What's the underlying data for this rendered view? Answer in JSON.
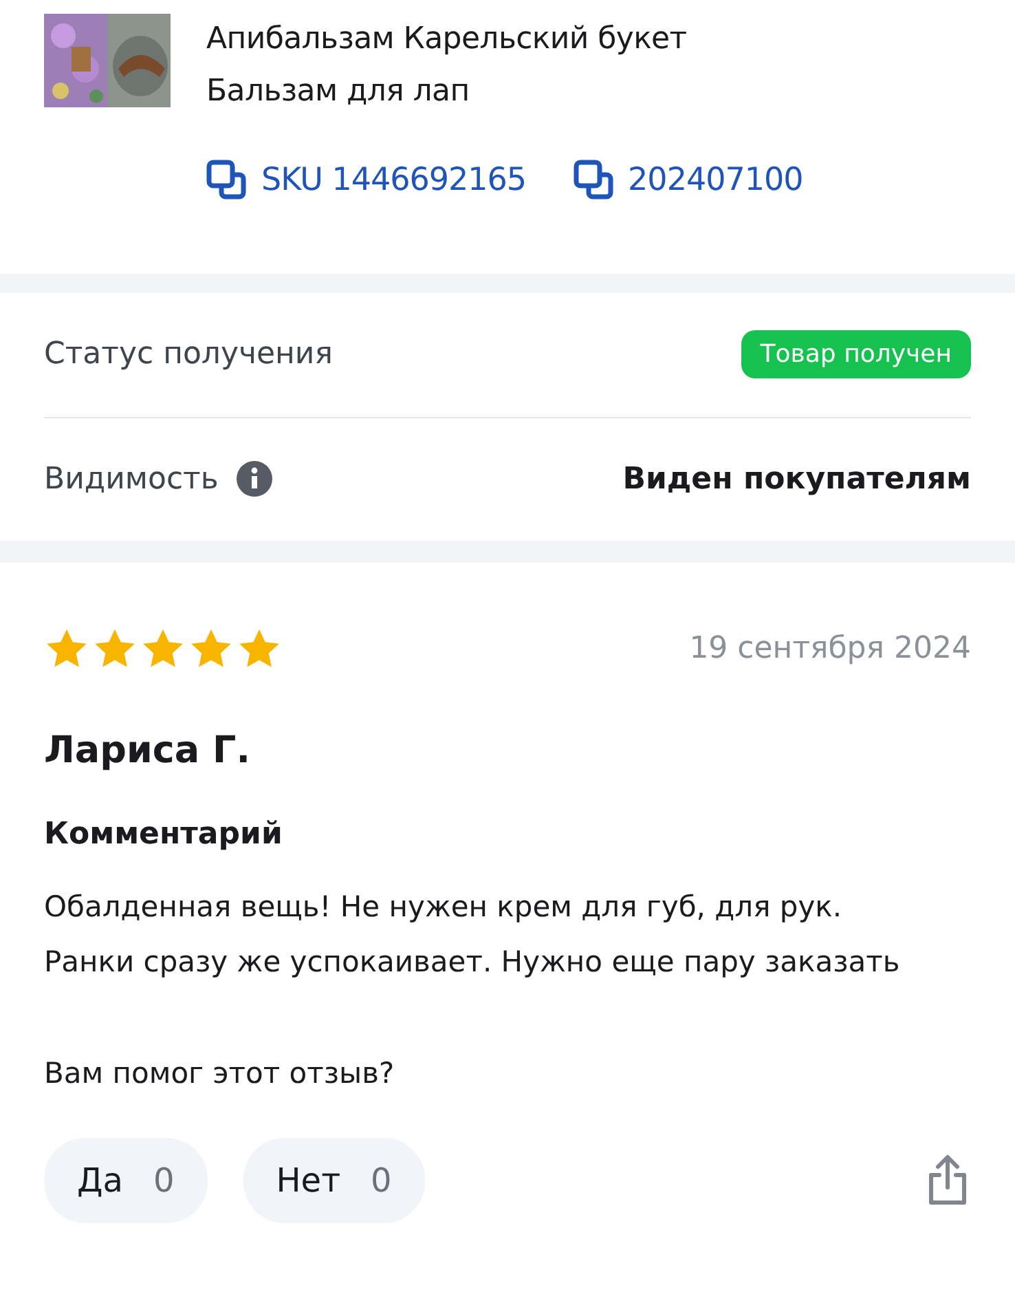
{
  "product": {
    "title": "Апибальзам Карельский букет",
    "subtitle": "Бальзам для лап",
    "codes": [
      "SKU 1446692165",
      "202407100"
    ]
  },
  "details": [
    {
      "kind": "badge",
      "label": "Статус получения",
      "value": "Товар получен"
    },
    {
      "kind": "text",
      "label": "Видимость",
      "info": true,
      "value": "Виден покупателям"
    }
  ],
  "review": {
    "stars": 5,
    "date": "19 сентября 2024",
    "author": "Лариса Г.",
    "comment_heading": "Комментарий",
    "comment": "Обалденная вещь! Не нужен крем для губ, для рук. Ранки сразу же успокаивает. Нужно еще пару заказать",
    "helpful_question": "Вам помог этот отзыв?",
    "votes": [
      {
        "label": "Да",
        "count": "0"
      },
      {
        "label": "Нет",
        "count": "0"
      }
    ]
  }
}
